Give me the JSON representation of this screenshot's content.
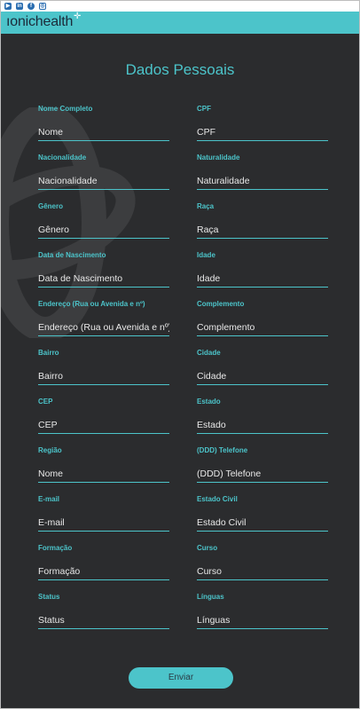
{
  "social": [
    {
      "name": "youtube-icon",
      "glyph": "▶"
    },
    {
      "name": "linkedin-icon",
      "glyph": "in"
    },
    {
      "name": "facebook-icon",
      "glyph": "f"
    },
    {
      "name": "instagram-icon",
      "glyph": "◎"
    }
  ],
  "brand": {
    "logo_text": "ıonichealth",
    "plus": "✛"
  },
  "form": {
    "title": "Dados Pessoais",
    "fields": [
      {
        "label": "Nome Completo",
        "value": "Nome"
      },
      {
        "label": "CPF",
        "value": "CPF"
      },
      {
        "label": "Nacionalidade",
        "value": "Nacionalidade"
      },
      {
        "label": "Naturalidade",
        "value": "Naturalidade"
      },
      {
        "label": "Gênero",
        "value": "Gênero"
      },
      {
        "label": "Raça",
        "value": "Raça"
      },
      {
        "label": "Data de Nascimento",
        "value": "Data de Nascimento"
      },
      {
        "label": "Idade",
        "value": "Idade"
      },
      {
        "label": "Endereço (Rua ou Avenida e nº)",
        "value": "Endereço (Rua ou Avenida e nº)"
      },
      {
        "label": "Complemento",
        "value": "Complemento"
      },
      {
        "label": "Bairro",
        "value": "Bairro"
      },
      {
        "label": "Cidade",
        "value": "Cidade"
      },
      {
        "label": "CEP",
        "value": "CEP"
      },
      {
        "label": "Estado",
        "value": "Estado"
      },
      {
        "label": "Região",
        "value": "Nome"
      },
      {
        "label": "(DDD) Telefone",
        "value": "(DDD) Telefone"
      },
      {
        "label": "E-mail",
        "value": "E-mail"
      },
      {
        "label": "Estado Civil",
        "value": "Estado Civil"
      },
      {
        "label": "Formação",
        "value": "Formação"
      },
      {
        "label": "Curso",
        "value": "Curso"
      },
      {
        "label": "Status",
        "value": "Status"
      },
      {
        "label": "Línguas",
        "value": "Línguas"
      }
    ],
    "submit_label": "Enviar"
  },
  "colors": {
    "accent": "#4cc4ca",
    "background": "#2b2c2e",
    "logo": "#1c2b3a"
  }
}
